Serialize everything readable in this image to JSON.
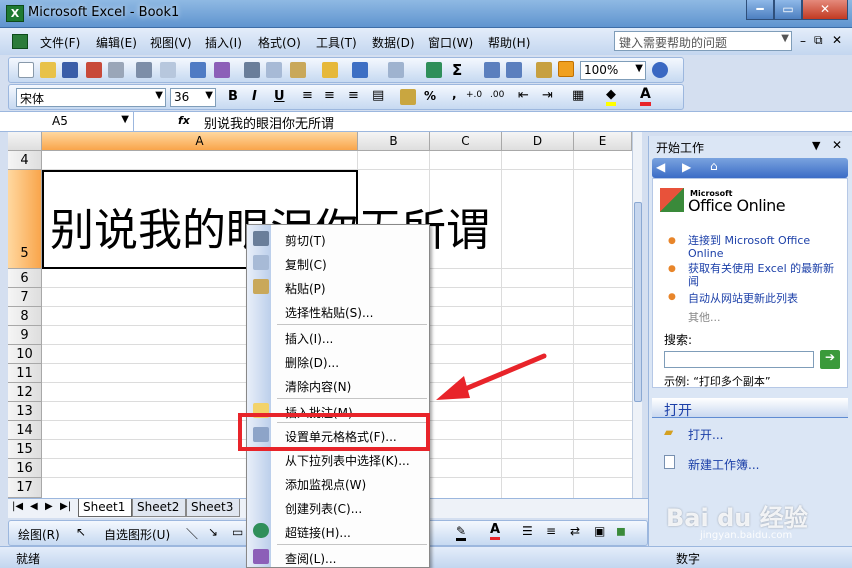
{
  "window": {
    "title": "Microsoft Excel - Book1",
    "app_icon": "X"
  },
  "menu": {
    "items": [
      "文件(F)",
      "编辑(E)",
      "视图(V)",
      "插入(I)",
      "格式(O)",
      "工具(T)",
      "数据(D)",
      "窗口(W)",
      "帮助(H)"
    ],
    "help_placeholder": "键入需要帮助的问题"
  },
  "toolbar": {
    "zoom": "100%",
    "font_name": "宋体",
    "font_size": "36"
  },
  "formula_bar": {
    "name_box": "A5",
    "fx": "fx",
    "content": "别说我的眼泪你无所谓"
  },
  "sheet": {
    "columns": [
      "A",
      "B",
      "C",
      "D",
      "E"
    ],
    "rows": [
      "4",
      "5",
      "6",
      "7",
      "8",
      "9",
      "10",
      "11",
      "12",
      "13",
      "14",
      "15",
      "16",
      "17"
    ],
    "cell_text": "别说我的眼泪你无所谓",
    "tabs": [
      "Sheet1",
      "Sheet2",
      "Sheet3"
    ]
  },
  "context_menu": {
    "items": [
      "剪切(T)",
      "复制(C)",
      "粘贴(P)",
      "选择性粘贴(S)...",
      "插入(I)...",
      "删除(D)...",
      "清除内容(N)",
      "插入批注(M)",
      "设置单元格格式(F)...",
      "从下拉列表中选择(K)...",
      "添加监视点(W)",
      "创建列表(C)...",
      "超链接(H)...",
      "查阅(L)..."
    ]
  },
  "task_pane": {
    "title": "开始工作",
    "logo": "Office Online",
    "logo_small": "Microsoft",
    "links": [
      "连接到 Microsoft Office Online",
      "获取有关使用 Excel 的最新新闻",
      "自动从网站更新此列表"
    ],
    "more": "其他...",
    "search_label": "搜索:",
    "example": "示例:  “打印多个副本”",
    "open_header": "打开",
    "open_link": "打开...",
    "new_link": "新建工作簿..."
  },
  "drawing": {
    "draw_label": "绘图(R)",
    "autoshape_label": "自选图形(U)"
  },
  "status": {
    "ready": "就绪",
    "num": "数字"
  },
  "watermark": {
    "text": "Bai du 经验",
    "sub": "jingyan.baidu.com"
  },
  "colors": {
    "accent": "#e8242a",
    "selection": "#f9a54b",
    "pane_header": "#3b6cc6"
  }
}
